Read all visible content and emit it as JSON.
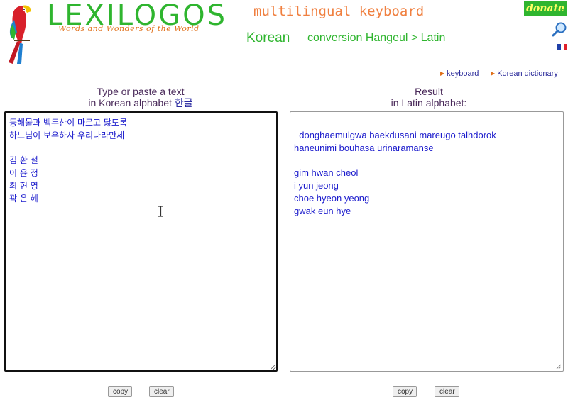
{
  "header": {
    "logo_title": "LEXILOGOS",
    "logo_tagline": "Words and Wonders of the World",
    "site_subtitle": "multilingual keyboard",
    "language": "Korean",
    "conversion": "conversion Hangeul > Latin",
    "donate_label": "donate",
    "icons": [
      "parrot-logo-icon",
      "search-icon",
      "french-flag-icon"
    ]
  },
  "links": {
    "keyboard": "keyboard",
    "dictionary": "Korean dictionary"
  },
  "left_panel": {
    "title_line1": "Type or paste a text",
    "title_line2_prefix": "in Korean alphabet ",
    "title_hangul": "한글",
    "input_text": "동해물과 백두산이 마르고 닳도록\n하느님이 보우하사 우리나라만세\n\n김 환 철\n이 윤 정\n최 현 영\n곽 은 혜",
    "copy_label": "copy",
    "clear_label": "clear"
  },
  "right_panel": {
    "title_line1": "Result",
    "title_line2": "in Latin alphabet:",
    "output_text": "donghaemulgwa baekdusani mareugo talhdorok\nhaneunimi bouhasa urinaramanse\n\ngim hwan cheol\ni yun jeong\nchoe hyeon yeong\ngwak eun hye",
    "copy_label": "copy",
    "clear_label": "clear"
  },
  "colors": {
    "green": "#2fb52f",
    "orange": "#f08040",
    "text_blue": "#1a1acc",
    "heading_purple": "#4a2a5a"
  }
}
